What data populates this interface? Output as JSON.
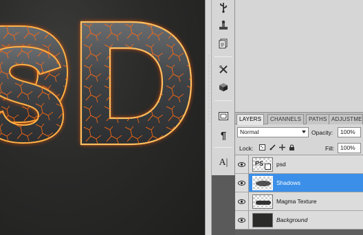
{
  "canvas": {
    "artwork_text": "PSD",
    "visible_glyphs": [
      "S",
      "D"
    ]
  },
  "tools": {
    "items": [
      {
        "icon": "usb-fork-icon"
      },
      {
        "icon": "clone-stamp-icon"
      },
      {
        "icon": "layer-comps-icon"
      },
      {
        "icon": "tools-preset-icon"
      },
      {
        "icon": "3d-cube-icon"
      },
      {
        "icon": "navigator-icon"
      },
      {
        "icon": "paragraph-icon"
      },
      {
        "icon": "character-icon"
      }
    ],
    "paragraph_glyph": "¶",
    "character_glyph": "A|"
  },
  "panel": {
    "tabs": [
      {
        "label": "LAYERS",
        "active": true
      },
      {
        "label": "CHANNELS",
        "active": false
      },
      {
        "label": "PATHS",
        "active": false
      },
      {
        "label": "ADJUSTME",
        "active": false
      }
    ],
    "blend_mode": "Normal",
    "opacity_label": "Opacity:",
    "opacity_value": "100%",
    "lock_label": "Lock:",
    "fill_label": "Fill:",
    "fill_value": "100%"
  },
  "layers": [
    {
      "name": "psd",
      "selected": false,
      "italic": false,
      "thumb": "text-layer"
    },
    {
      "name": "Shadows",
      "selected": true,
      "italic": false,
      "thumb": "shadows"
    },
    {
      "name": "Magma Texture",
      "selected": false,
      "italic": false,
      "thumb": "magma"
    },
    {
      "name": "Background",
      "selected": false,
      "italic": true,
      "thumb": "background"
    }
  ],
  "colors": {
    "selection": "#3b8fe8",
    "panel_bg": "#d6d6d6",
    "canvas_bg": "#262625",
    "lava_glow": "#ff7a1a",
    "rock": "#4a4d50"
  }
}
